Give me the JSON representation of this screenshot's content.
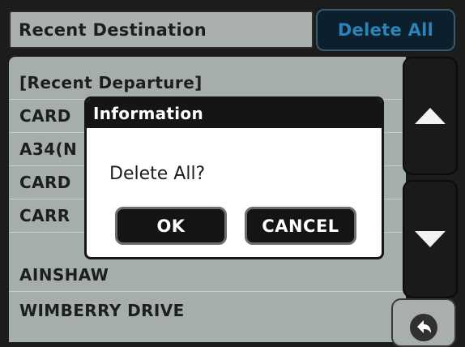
{
  "header": {
    "title": "Recent Destination",
    "delete_all_label": "Delete All"
  },
  "list": {
    "items": [
      {
        "label": "[Recent Departure]"
      },
      {
        "label": "CARD"
      },
      {
        "label": "A34(N"
      },
      {
        "label": "CARD"
      },
      {
        "label": "CARR"
      },
      {
        "label": "AINSHAW"
      },
      {
        "label": "WIMBERRY DRIVE"
      }
    ]
  },
  "scroll": {
    "up_icon": "triangle-up-icon",
    "down_icon": "triangle-down-icon",
    "back_icon": "back-arrow-icon"
  },
  "dialog": {
    "title": "Information",
    "message": "Delete All?",
    "ok_label": "OK",
    "cancel_label": "CANCEL"
  },
  "colors": {
    "list_bg": "#a6adad",
    "dark": "#151515",
    "accent_text": "#2b83b8"
  }
}
